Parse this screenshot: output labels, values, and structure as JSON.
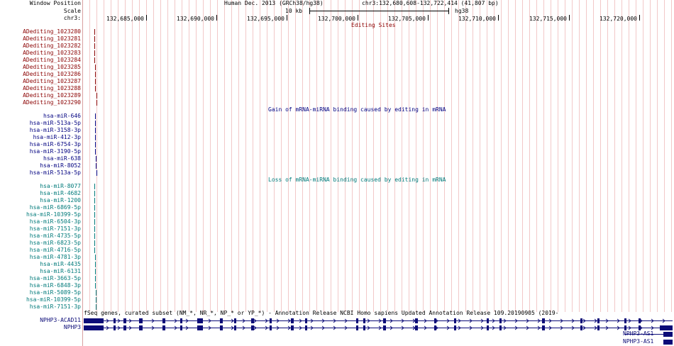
{
  "header": {
    "window_position_label": "Window Position",
    "scale_label": "Scale",
    "chrom_label": "chr3:",
    "assembly": "Human Dec. 2013 (GRCh38/hg38)",
    "position": "chr3:132,680,608-132,722,414 (41,807 bp)",
    "scale_value": "10 kb",
    "scale_assembly": "hg38",
    "ruler_ticks": [
      "132,685,000",
      "132,690,000",
      "132,695,000",
      "132,700,000",
      "132,705,000",
      "132,710,000",
      "132,715,000",
      "132,720,000"
    ]
  },
  "colors": {
    "editing": "#8b0000",
    "gain": "#000080",
    "loss": "#007a7a",
    "gene": "#0c0c78",
    "grid": "#f2c8c8"
  },
  "tracks": {
    "editing": {
      "title": "Editing Sites",
      "items": [
        "ADediting_1023280",
        "ADediting_1023281",
        "ADediting_1023282",
        "ADediting_1023283",
        "ADediting_1023284",
        "ADediting_1023285",
        "ADediting_1023286",
        "ADediting_1023287",
        "ADediting_1023288",
        "ADediting_1023289",
        "ADediting_1023290"
      ]
    },
    "gain": {
      "title": "Gain of mRNA-miRNA binding caused by editing in mRNA",
      "items": [
        "hsa-miR-646",
        "hsa-miR-513a-5p",
        "hsa-miR-3158-3p",
        "hsa-miR-412-3p",
        "hsa-miR-6754-3p",
        "hsa-miR-3190-5p",
        "hsa-miR-638",
        "hsa-miR-8052",
        "hsa-miR-513a-5p"
      ]
    },
    "loss": {
      "title": "Loss of mRNA-miRNA binding caused by editing in mRNA",
      "items": [
        "hsa-miR-8077",
        "hsa-miR-4682",
        "hsa-miR-1200",
        "hsa-miR-6869-5p",
        "hsa-miR-10399-5p",
        "hsa-miR-6504-3p",
        "hsa-miR-7151-3p",
        "hsa-miR-4735-5p",
        "hsa-miR-6823-5p",
        "hsa-miR-4716-5p",
        "hsa-miR-4781-3p",
        "hsa-miR-4435",
        "hsa-miR-6131",
        "hsa-miR-3663-5p",
        "hsa-miR-6848-3p",
        "hsa-miR-5089-5p",
        "hsa-miR-10399-5p",
        "hsa-miR-7151-3p"
      ]
    },
    "genes": {
      "title": "fSeq genes, curated subset (NM_*, NR_*, NP_* or YP_*) - Annotation Release NCBI Homo sapiens Updated Annotation Release 109.20190905 (2019-",
      "items": [
        "NPHP3-ACAD11",
        "NPHP3"
      ],
      "right_labels": [
        "NPHP3-AS1",
        "NPHP3-AS1"
      ]
    }
  }
}
